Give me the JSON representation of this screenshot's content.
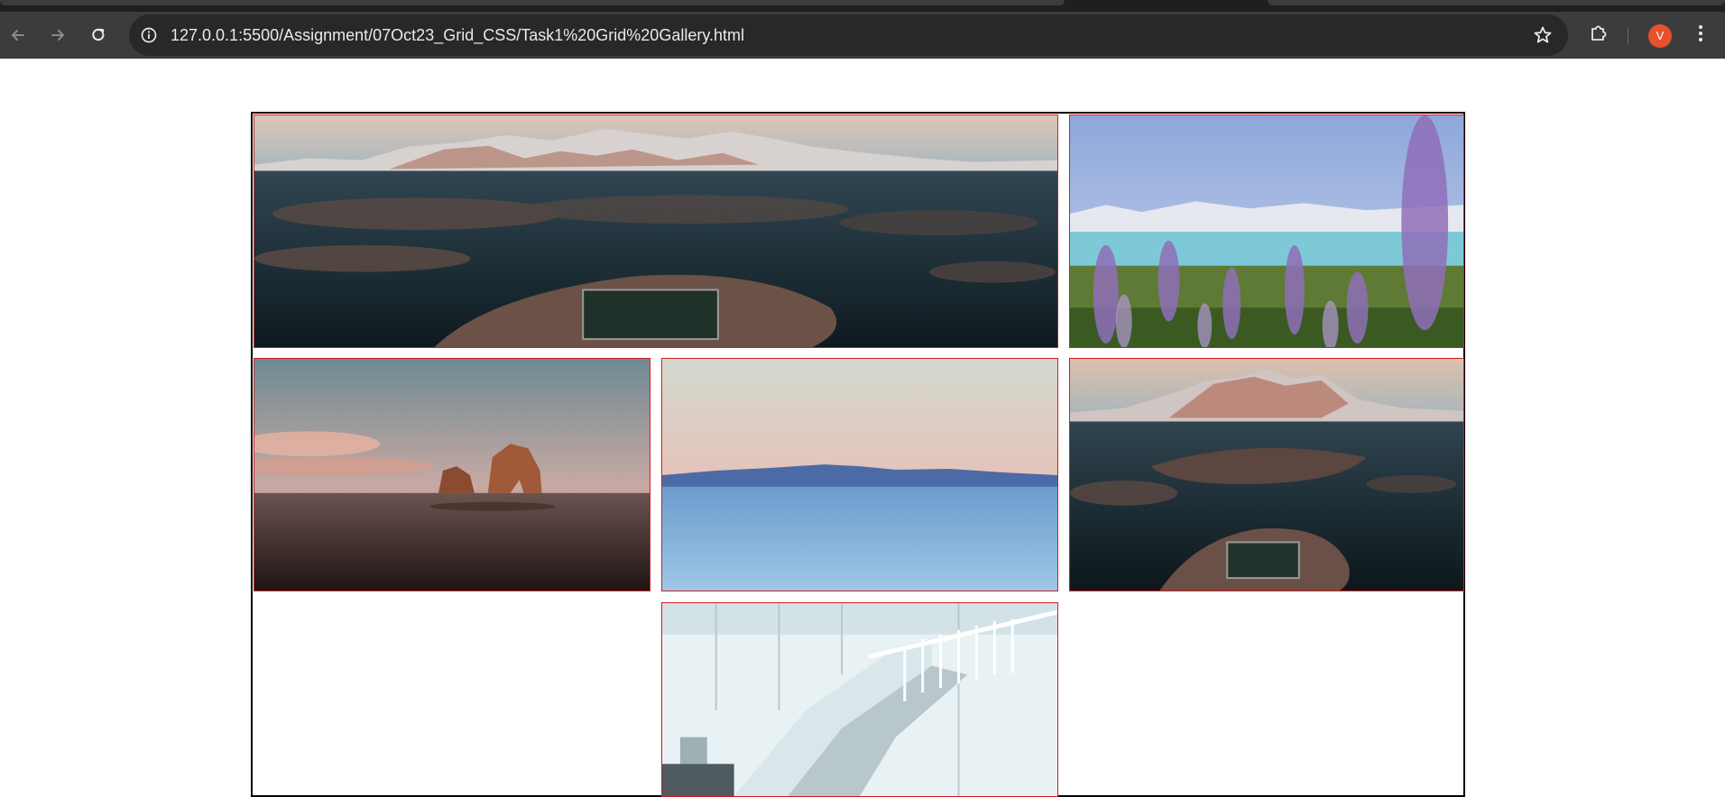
{
  "browser": {
    "url": "127.0.0.1:5500/Assignment/07Oct23_Grid_CSS/Task1%20Grid%20Gallery.html",
    "profile_initial": "V",
    "accent_colors": {
      "chrome_bg": "#3c3c3c",
      "omnibox_bg": "#282828",
      "avatar_bg": "#e8512c"
    },
    "icons": [
      "back-arrow-icon",
      "forward-arrow-icon",
      "reload-icon",
      "info-icon",
      "star-icon",
      "extensions-puzzle-icon",
      "kebab-menu-icon"
    ]
  },
  "gallery": {
    "border_color": "#000000",
    "image_border_color": "#d11d1d",
    "images": [
      {
        "subject": "aerial fjord islands with snowy mountains"
      },
      {
        "subject": "purple lupine flowers by turquoise lake"
      },
      {
        "subject": "sea stack rocks at beach sunset"
      },
      {
        "subject": "mountain ridge above sea of clouds"
      },
      {
        "subject": "aerial island village with snowy peaks"
      },
      {
        "subject": "white spiral staircase interior"
      }
    ]
  }
}
